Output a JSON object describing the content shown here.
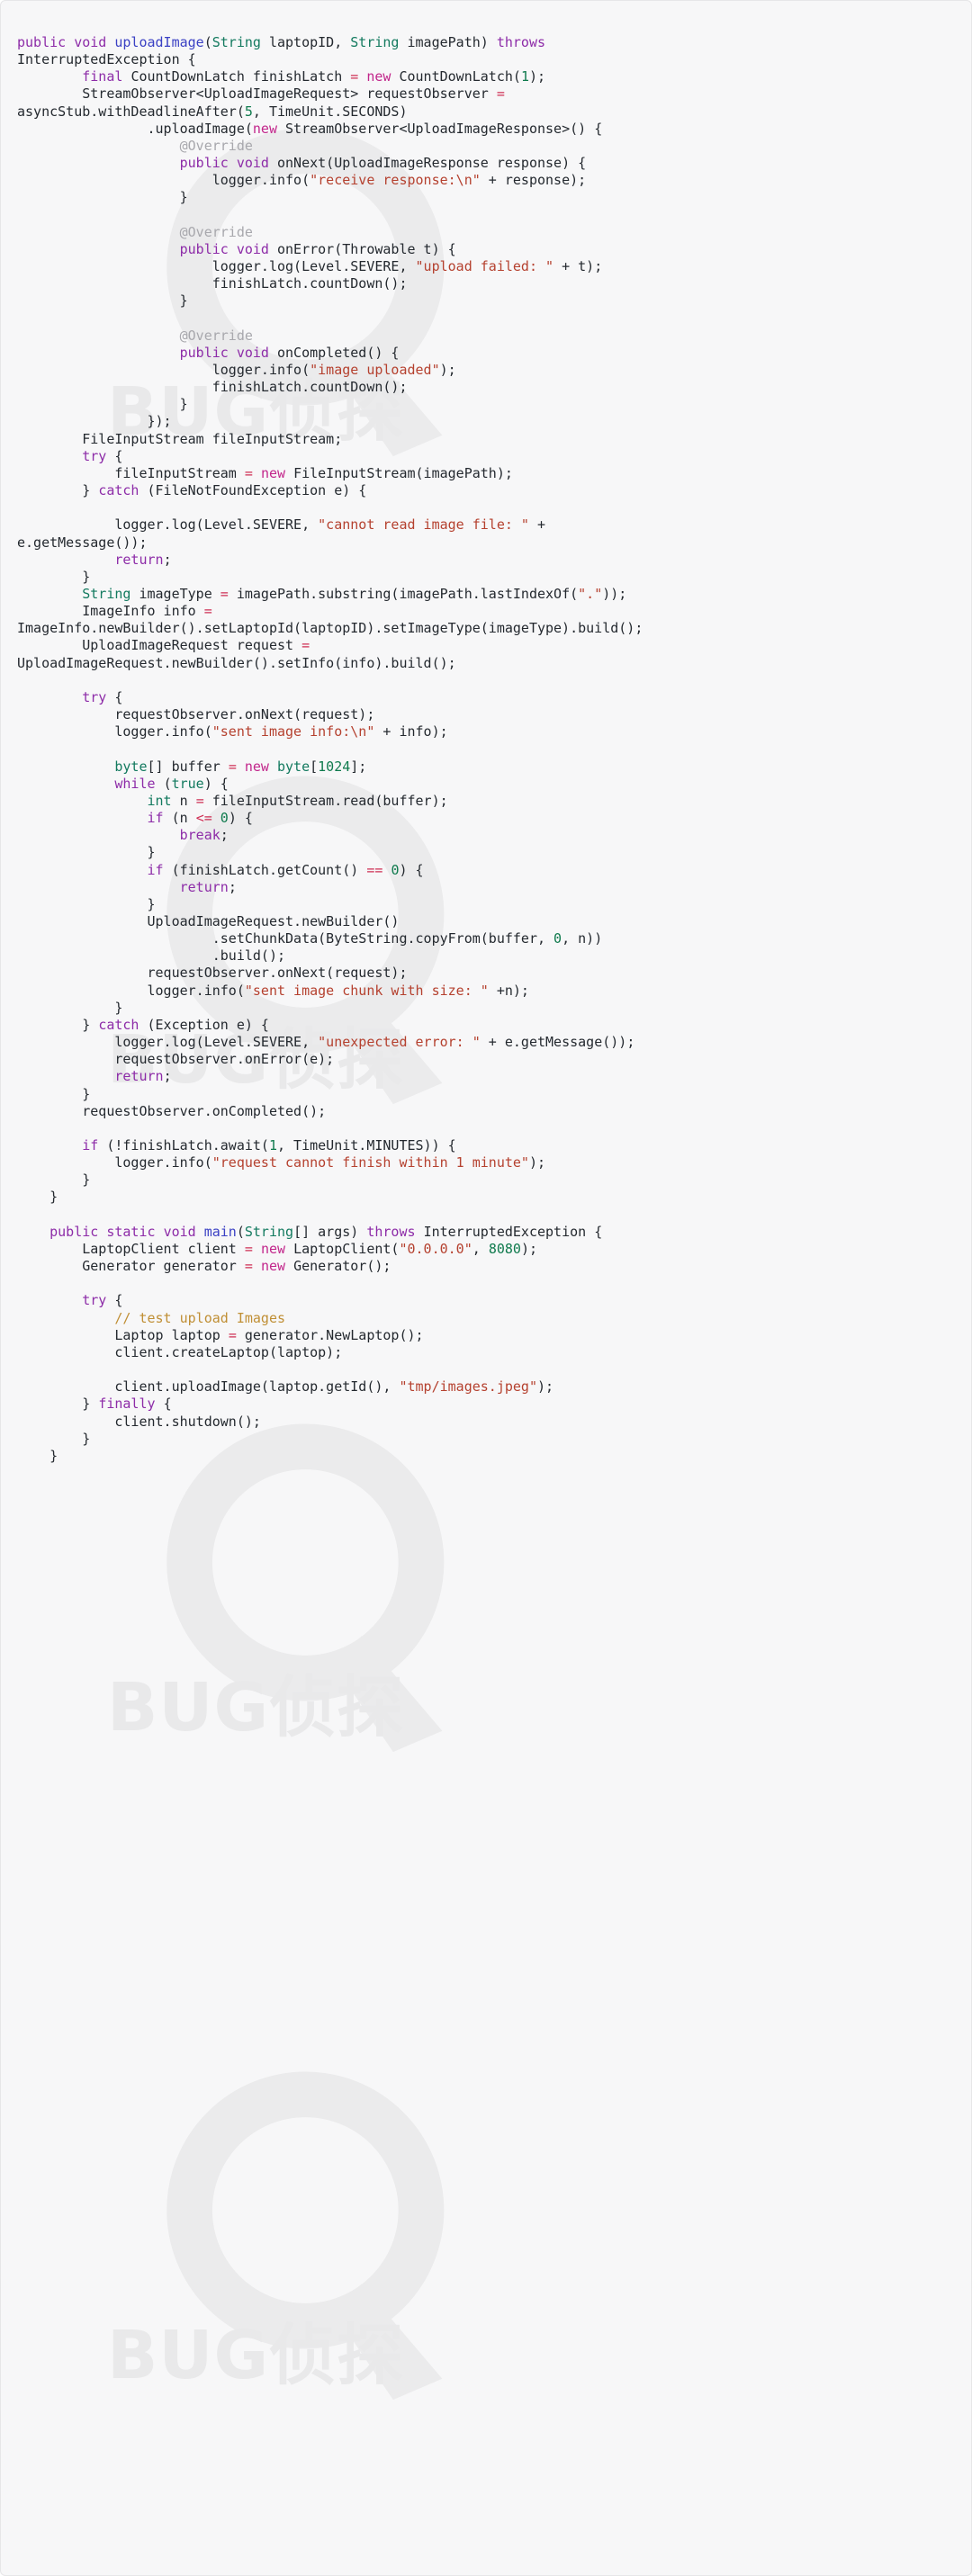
{
  "card": {
    "language": "java",
    "background": "#f7f7f8",
    "border_color": "#e6e6e8",
    "text_color": "#24292f"
  },
  "palette": {
    "keyword": "#8d2ca8",
    "new_keyword": "#c2268b",
    "type": "#137a5f",
    "function": "#3b41c4",
    "string": "#b5412f",
    "number": "#0f7a4d",
    "operator": "#cf2f54",
    "annotation": "#a8a8ad",
    "comment": "#c08f35",
    "plain": "#24292f"
  },
  "watermark": {
    "logo_glyph": "Q",
    "text": "BUG侦探",
    "color": "#e9e9ea",
    "repeats": 4
  },
  "code": {
    "lines": [
      [
        [
          "kw",
          "public "
        ],
        [
          "kw",
          "void "
        ],
        [
          "fn",
          "uploadImage"
        ],
        [
          "plain",
          "("
        ],
        [
          "type",
          "String"
        ],
        [
          "plain",
          " laptopID, "
        ],
        [
          "type",
          "String"
        ],
        [
          "plain",
          " imagePath) "
        ],
        [
          "kw",
          "throws"
        ]
      ],
      [
        [
          "plain",
          "InterruptedException {"
        ]
      ],
      [
        [
          "plain",
          "        "
        ],
        [
          "kw",
          "final "
        ],
        [
          "plain",
          "CountDownLatch finishLatch "
        ],
        [
          "op",
          "= "
        ],
        [
          "new",
          "new "
        ],
        [
          "plain",
          "CountDownLatch("
        ],
        [
          "num",
          "1"
        ],
        [
          "plain",
          ");"
        ]
      ],
      [
        [
          "plain",
          "        StreamObserver<UploadImageRequest> requestObserver "
        ],
        [
          "op",
          "="
        ]
      ],
      [
        [
          "plain",
          "asyncStub.withDeadlineAfter("
        ],
        [
          "num",
          "5"
        ],
        [
          "plain",
          ", TimeUnit.SECONDS)"
        ]
      ],
      [
        [
          "plain",
          "                .uploadImage("
        ],
        [
          "new",
          "new "
        ],
        [
          "plain",
          "StreamObserver<UploadImageResponse>() {"
        ]
      ],
      [
        [
          "plain",
          "                    "
        ],
        [
          "ann",
          "@Override"
        ]
      ],
      [
        [
          "plain",
          "                    "
        ],
        [
          "kw",
          "public "
        ],
        [
          "kw",
          "void "
        ],
        [
          "plain",
          "onNext(UploadImageResponse response) {"
        ]
      ],
      [
        [
          "plain",
          "                        logger.info("
        ],
        [
          "str",
          "\"receive response:\\n\""
        ],
        [
          "plain",
          " + response);"
        ]
      ],
      [
        [
          "plain",
          "                    }"
        ]
      ],
      [
        [
          "plain",
          ""
        ]
      ],
      [
        [
          "plain",
          "                    "
        ],
        [
          "ann",
          "@Override"
        ]
      ],
      [
        [
          "plain",
          "                    "
        ],
        [
          "kw",
          "public "
        ],
        [
          "kw",
          "void "
        ],
        [
          "plain",
          "onError(Throwable t) {"
        ]
      ],
      [
        [
          "plain",
          "                        logger.log(Level.SEVERE, "
        ],
        [
          "str",
          "\"upload failed: \""
        ],
        [
          "plain",
          " + t);"
        ]
      ],
      [
        [
          "plain",
          "                        finishLatch.countDown();"
        ]
      ],
      [
        [
          "plain",
          "                    }"
        ]
      ],
      [
        [
          "plain",
          ""
        ]
      ],
      [
        [
          "plain",
          "                    "
        ],
        [
          "ann",
          "@Override"
        ]
      ],
      [
        [
          "plain",
          "                    "
        ],
        [
          "kw",
          "public "
        ],
        [
          "kw",
          "void "
        ],
        [
          "plain",
          "onCompleted() {"
        ]
      ],
      [
        [
          "plain",
          "                        logger.info("
        ],
        [
          "str",
          "\"image uploaded\""
        ],
        [
          "plain",
          ");"
        ]
      ],
      [
        [
          "plain",
          "                        finishLatch.countDown();"
        ]
      ],
      [
        [
          "plain",
          "                    }"
        ]
      ],
      [
        [
          "plain",
          "                });"
        ]
      ],
      [
        [
          "plain",
          "        FileInputStream fileInputStream;"
        ]
      ],
      [
        [
          "plain",
          "        "
        ],
        [
          "kw",
          "try"
        ],
        [
          "plain",
          " {"
        ]
      ],
      [
        [
          "plain",
          "            fileInputStream "
        ],
        [
          "op",
          "= "
        ],
        [
          "new",
          "new "
        ],
        [
          "plain",
          "FileInputStream(imagePath);"
        ]
      ],
      [
        [
          "plain",
          "        } "
        ],
        [
          "kw",
          "catch "
        ],
        [
          "plain",
          "(FileNotFoundException e) {"
        ]
      ],
      [
        [
          "plain",
          ""
        ]
      ],
      [
        [
          "plain",
          "            logger.log(Level.SEVERE, "
        ],
        [
          "str",
          "\"cannot read image file: \""
        ],
        [
          "plain",
          " +"
        ]
      ],
      [
        [
          "plain",
          "e.getMessage());"
        ]
      ],
      [
        [
          "plain",
          "            "
        ],
        [
          "kw",
          "return"
        ],
        [
          "plain",
          ";"
        ]
      ],
      [
        [
          "plain",
          "        }"
        ]
      ],
      [
        [
          "plain",
          "        "
        ],
        [
          "type",
          "String "
        ],
        [
          "plain",
          "imageType "
        ],
        [
          "op",
          "= "
        ],
        [
          "plain",
          "imagePath.substring(imagePath.lastIndexOf("
        ],
        [
          "str",
          "\".\""
        ],
        [
          "plain",
          "));"
        ]
      ],
      [
        [
          "plain",
          "        ImageInfo info "
        ],
        [
          "op",
          "="
        ]
      ],
      [
        [
          "plain",
          "ImageInfo.newBuilder().setLaptopId(laptopID).setImageType(imageType).build();"
        ]
      ],
      [
        [
          "plain",
          "        UploadImageRequest request "
        ],
        [
          "op",
          "="
        ]
      ],
      [
        [
          "plain",
          "UploadImageRequest.newBuilder().setInfo(info).build();"
        ]
      ],
      [
        [
          "plain",
          ""
        ]
      ],
      [
        [
          "plain",
          "        "
        ],
        [
          "kw",
          "try"
        ],
        [
          "plain",
          " {"
        ]
      ],
      [
        [
          "plain",
          "            requestObserver.onNext(request);"
        ]
      ],
      [
        [
          "plain",
          "            logger.info("
        ],
        [
          "str",
          "\"sent image info:\\n\""
        ],
        [
          "plain",
          " + info);"
        ]
      ],
      [
        [
          "plain",
          ""
        ]
      ],
      [
        [
          "plain",
          "            "
        ],
        [
          "type",
          "byte"
        ],
        [
          "plain",
          "[] buffer "
        ],
        [
          "op",
          "= "
        ],
        [
          "new",
          "new "
        ],
        [
          "type",
          "byte"
        ],
        [
          "plain",
          "["
        ],
        [
          "num",
          "1024"
        ],
        [
          "plain",
          "];"
        ]
      ],
      [
        [
          "plain",
          "            "
        ],
        [
          "kw",
          "while "
        ],
        [
          "plain",
          "("
        ],
        [
          "type",
          "true"
        ],
        [
          "plain",
          ") {"
        ]
      ],
      [
        [
          "plain",
          "                "
        ],
        [
          "type",
          "int "
        ],
        [
          "plain",
          "n "
        ],
        [
          "op",
          "= "
        ],
        [
          "plain",
          "fileInputStream.read(buffer);"
        ]
      ],
      [
        [
          "plain",
          "                "
        ],
        [
          "kw",
          "if "
        ],
        [
          "plain",
          "(n "
        ],
        [
          "op",
          "<= "
        ],
        [
          "num",
          "0"
        ],
        [
          "plain",
          ") {"
        ]
      ],
      [
        [
          "plain",
          "                    "
        ],
        [
          "kw",
          "break"
        ],
        [
          "plain",
          ";"
        ]
      ],
      [
        [
          "plain",
          "                }"
        ]
      ],
      [
        [
          "plain",
          "                "
        ],
        [
          "kw",
          "if "
        ],
        [
          "plain",
          "(finishLatch.getCount() "
        ],
        [
          "op",
          "== "
        ],
        [
          "num",
          "0"
        ],
        [
          "plain",
          ") {"
        ]
      ],
      [
        [
          "plain",
          "                    "
        ],
        [
          "kw",
          "return"
        ],
        [
          "plain",
          ";"
        ]
      ],
      [
        [
          "plain",
          "                }"
        ]
      ],
      [
        [
          "plain",
          "                UploadImageRequest.newBuilder()"
        ]
      ],
      [
        [
          "plain",
          "                        .setChunkData(ByteString.copyFrom(buffer, "
        ],
        [
          "num",
          "0"
        ],
        [
          "plain",
          ", n))"
        ]
      ],
      [
        [
          "plain",
          "                        .build();"
        ]
      ],
      [
        [
          "plain",
          "                requestObserver.onNext(request);"
        ]
      ],
      [
        [
          "plain",
          "                logger.info("
        ],
        [
          "str",
          "\"sent image chunk with size: \""
        ],
        [
          "plain",
          " +n);"
        ]
      ],
      [
        [
          "plain",
          "            }"
        ]
      ],
      [
        [
          "plain",
          "        } "
        ],
        [
          "kw",
          "catch "
        ],
        [
          "plain",
          "(Exception e) {"
        ]
      ],
      [
        [
          "plain",
          "            logger.log(Level.SEVERE, "
        ],
        [
          "str",
          "\"unexpected error: \""
        ],
        [
          "plain",
          " + e.getMessage());"
        ]
      ],
      [
        [
          "plain",
          "            requestObserver.onError(e);"
        ]
      ],
      [
        [
          "plain",
          "            "
        ],
        [
          "kw",
          "return"
        ],
        [
          "plain",
          ";"
        ]
      ],
      [
        [
          "plain",
          "        }"
        ]
      ],
      [
        [
          "plain",
          "        requestObserver.onCompleted();"
        ]
      ],
      [
        [
          "plain",
          ""
        ]
      ],
      [
        [
          "plain",
          "        "
        ],
        [
          "kw",
          "if "
        ],
        [
          "plain",
          "(!finishLatch.await("
        ],
        [
          "num",
          "1"
        ],
        [
          "plain",
          ", TimeUnit.MINUTES)) {"
        ]
      ],
      [
        [
          "plain",
          "            logger.info("
        ],
        [
          "str",
          "\"request cannot finish within 1 minute\""
        ],
        [
          "plain",
          ");"
        ]
      ],
      [
        [
          "plain",
          "        }"
        ]
      ],
      [
        [
          "plain",
          "    }"
        ]
      ],
      [
        [
          "plain",
          ""
        ]
      ],
      [
        [
          "plain",
          "    "
        ],
        [
          "kw",
          "public "
        ],
        [
          "kw",
          "static "
        ],
        [
          "kw",
          "void "
        ],
        [
          "fn",
          "main"
        ],
        [
          "plain",
          "("
        ],
        [
          "type",
          "String"
        ],
        [
          "plain",
          "[] args) "
        ],
        [
          "kw",
          "throws "
        ],
        [
          "plain",
          "InterruptedException {"
        ]
      ],
      [
        [
          "plain",
          "        LaptopClient client "
        ],
        [
          "op",
          "= "
        ],
        [
          "new",
          "new "
        ],
        [
          "plain",
          "LaptopClient("
        ],
        [
          "str",
          "\"0.0.0.0\""
        ],
        [
          "plain",
          ", "
        ],
        [
          "num",
          "8080"
        ],
        [
          "plain",
          ");"
        ]
      ],
      [
        [
          "plain",
          "        Generator generator "
        ],
        [
          "op",
          "= "
        ],
        [
          "new",
          "new "
        ],
        [
          "plain",
          "Generator();"
        ]
      ],
      [
        [
          "plain",
          ""
        ]
      ],
      [
        [
          "plain",
          "        "
        ],
        [
          "kw",
          "try"
        ],
        [
          "plain",
          " {"
        ]
      ],
      [
        [
          "plain",
          "            "
        ],
        [
          "cmt",
          "// test upload Images"
        ]
      ],
      [
        [
          "plain",
          "            Laptop laptop "
        ],
        [
          "op",
          "= "
        ],
        [
          "plain",
          "generator.NewLaptop();"
        ]
      ],
      [
        [
          "plain",
          "            client.createLaptop(laptop);"
        ]
      ],
      [
        [
          "plain",
          ""
        ]
      ],
      [
        [
          "plain",
          "            client.uploadImage(laptop.getId(), "
        ],
        [
          "str",
          "\"tmp/images.jpeg\""
        ],
        [
          "plain",
          ");"
        ]
      ],
      [
        [
          "plain",
          "        } "
        ],
        [
          "kw",
          "finally "
        ],
        [
          "plain",
          "{"
        ]
      ],
      [
        [
          "plain",
          "            client.shutdown();"
        ]
      ],
      [
        [
          "plain",
          "        }"
        ]
      ],
      [
        [
          "plain",
          "    }"
        ]
      ]
    ],
    "plain_text": "public void uploadImage(String laptopID, String imagePath) throws InterruptedException {\n        final CountDownLatch finishLatch = new CountDownLatch(1);\n        StreamObserver<UploadImageRequest> requestObserver = asyncStub.withDeadlineAfter(5, TimeUnit.SECONDS)\n                .uploadImage(new StreamObserver<UploadImageResponse>() {\n                    @Override\n                    public void onNext(UploadImageResponse response) {\n                        logger.info(\"receive response:\\n\" + response);\n                    }\n\n                    @Override\n                    public void onError(Throwable t) {\n                        logger.log(Level.SEVERE, \"upload failed: \" + t);\n                        finishLatch.countDown();\n                    }\n\n                    @Override\n                    public void onCompleted() {\n                        logger.info(\"image uploaded\");\n                        finishLatch.countDown();\n                    }\n                });\n        FileInputStream fileInputStream;\n        try {\n            fileInputStream = new FileInputStream(imagePath);\n        } catch (FileNotFoundException e) {\n\n            logger.log(Level.SEVERE, \"cannot read image file: \" + e.getMessage());\n            return;\n        }\n        String imageType = imagePath.substring(imagePath.lastIndexOf(\".\"));\n        ImageInfo info = ImageInfo.newBuilder().setLaptopId(laptopID).setImageType(imageType).build();\n        UploadImageRequest request = UploadImageRequest.newBuilder().setInfo(info).build();\n\n        try {\n            requestObserver.onNext(request);\n            logger.info(\"sent image info:\\n\" + info);\n\n            byte[] buffer = new byte[1024];\n            while (true) {\n                int n = fileInputStream.read(buffer);\n                if (n <= 0) {\n                    break;\n                }\n                if (finishLatch.getCount() == 0) {\n                    return;\n                }\n                UploadImageRequest.newBuilder()\n                        .setChunkData(ByteString.copyFrom(buffer, 0, n))\n                        .build();\n                requestObserver.onNext(request);\n                logger.info(\"sent image chunk with size: \" +n);\n            }\n        } catch (Exception e) {\n            logger.log(Level.SEVERE, \"unexpected error: \" + e.getMessage());\n            requestObserver.onError(e);\n            return;\n        }\n        requestObserver.onCompleted();\n\n        if (!finishLatch.await(1, TimeUnit.MINUTES)) {\n            logger.info(\"request cannot finish within 1 minute\");\n        }\n    }\n\n    public static void main(String[] args) throws InterruptedException {\n        LaptopClient client = new LaptopClient(\"0.0.0.0\", 8080);\n        Generator generator = new Generator();\n\n        try {\n            // test upload Images\n            Laptop laptop = generator.NewLaptop();\n            client.createLaptop(laptop);\n\n            client.uploadImage(laptop.getId(), \"tmp/images.jpeg\");\n        } finally {\n            client.shutdown();\n        }\n    }"
  }
}
